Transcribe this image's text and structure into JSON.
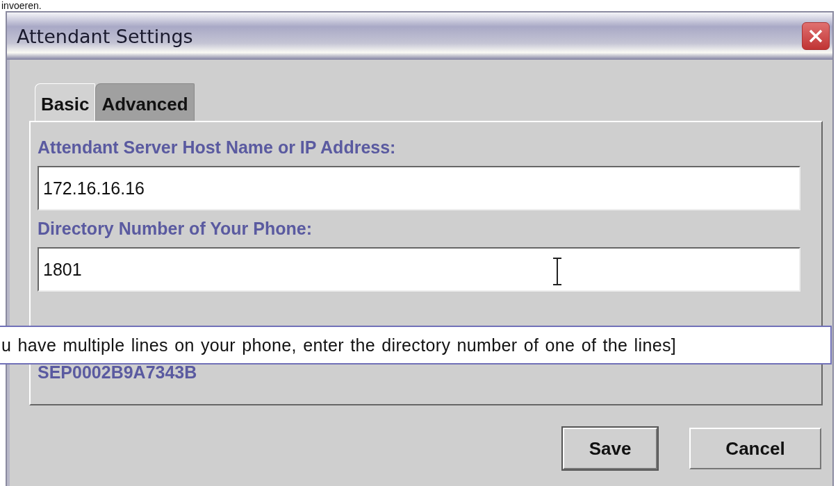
{
  "page_caption": "invoeren.",
  "window": {
    "title": "Attendant Settings"
  },
  "tabs": [
    {
      "label": "Basic",
      "selected": true
    },
    {
      "label": "Advanced",
      "selected": false
    }
  ],
  "fields": [
    {
      "label": "Attendant Server Host Name or IP Address:",
      "value": "172.16.16.16"
    },
    {
      "label": "Directory Number of Your Phone:",
      "value": "1801"
    }
  ],
  "tooltip": "u have multiple lines on your phone, enter the directory number of one of the lines]",
  "mac_value": "SEP0002B9A7343B",
  "buttons": [
    {
      "label": "Save",
      "default": true
    },
    {
      "label": "Cancel",
      "default": false
    }
  ]
}
